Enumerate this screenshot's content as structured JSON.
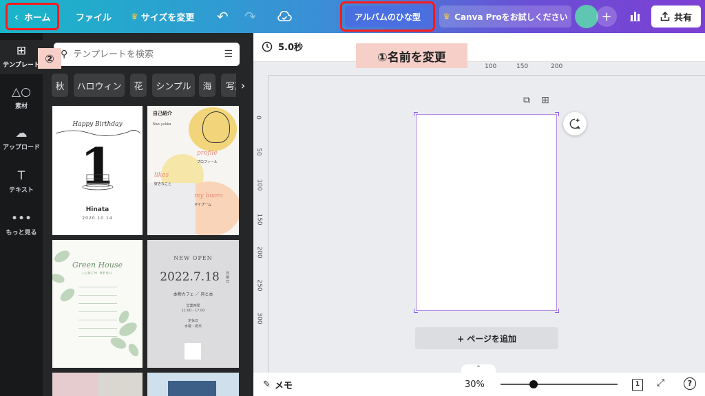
{
  "topbar": {
    "home_label": "ホーム",
    "file_label": "ファイル",
    "resize_label": "サイズを変更",
    "design_title": "アルバムのひな型",
    "pro_label": "Canva Proをお試しください",
    "share_label": "共有",
    "icons": [
      "chevron-left-icon",
      "crown-icon",
      "undo-icon",
      "redo-icon",
      "cloud-sync-icon",
      "plus-icon",
      "bar-chart-icon",
      "upload-icon"
    ]
  },
  "rail": {
    "items": [
      {
        "label": "テンプレート",
        "icon": "template-icon"
      },
      {
        "label": "素材",
        "icon": "elements-icon"
      },
      {
        "label": "アップロード",
        "icon": "upload-cloud-icon"
      },
      {
        "label": "テキスト",
        "icon": "text-icon"
      },
      {
        "label": "もっと見る",
        "icon": "more-icon"
      }
    ]
  },
  "panel": {
    "search_placeholder": "テンプレートを検索",
    "chips": [
      "秋",
      "ハロウィン",
      "花",
      "シンプル",
      "海",
      "写真"
    ],
    "templates": [
      {
        "heading": "Happy Birthday",
        "number": "1",
        "name": "Hinata",
        "date": "2020.10.14"
      },
      {
        "heading": "自己紹介",
        "name": "Nao yukka",
        "sec1": "profile",
        "sec1_jp": "プロフィール",
        "sec2": "likes",
        "sec2_jp": "好きなこと",
        "sec3": "my boom",
        "sec3_jp": "マイブーム"
      },
      {
        "heading": "Green House",
        "sub": "LUNCH MENU"
      },
      {
        "heading": "NEW OPEN",
        "date": "2022.7.18",
        "side": "月曜日",
        "venue": "本物カフェ ／ 月と本",
        "hours_label": "営業時間",
        "hours": "11:00 - 17:00",
        "closed_label": "定休日",
        "closed": "水曜・祝日"
      }
    ]
  },
  "canvas": {
    "duration": "5.0秒",
    "ruler_h": [
      "100",
      "150",
      "200"
    ],
    "ruler_v": [
      "0",
      "50",
      "100",
      "150",
      "200",
      "250",
      "300"
    ],
    "add_page_label": "+ ページを追加"
  },
  "bottombar": {
    "memo_label": "メモ",
    "zoom_label": "30%",
    "zoom_level": 0.28,
    "page_count": "1"
  },
  "annotations": {
    "step1": "①名前を変更",
    "step2": "②"
  },
  "colors": {
    "highlight_border": "#ff1a1a",
    "annotation_bg": "#f6cfc9",
    "title_button": "#4a6fe0"
  }
}
